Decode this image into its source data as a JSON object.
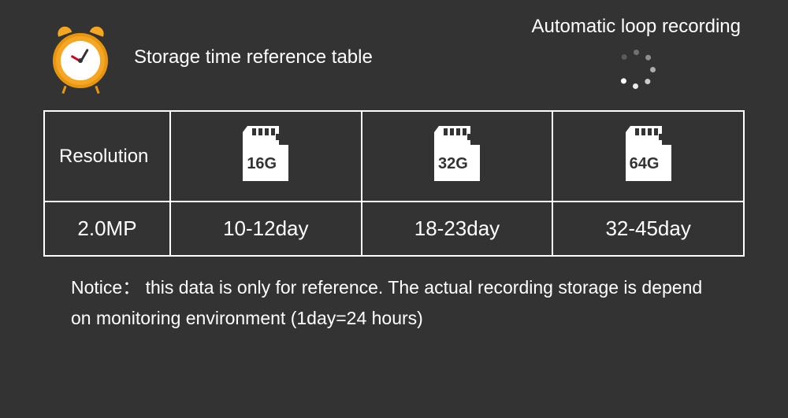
{
  "title": "Storage time reference table",
  "loop_title": "Automatic loop recording",
  "table": {
    "header_label": "Resolution",
    "capacities": [
      "16G",
      "32G",
      "64G"
    ],
    "resolution": "2.0MP",
    "durations": [
      "10-12day",
      "18-23day",
      "32-45day"
    ]
  },
  "notice": "Notice： this data is only for reference. The actual recording storage is depend on monitoring environment (1day=24 hours)"
}
